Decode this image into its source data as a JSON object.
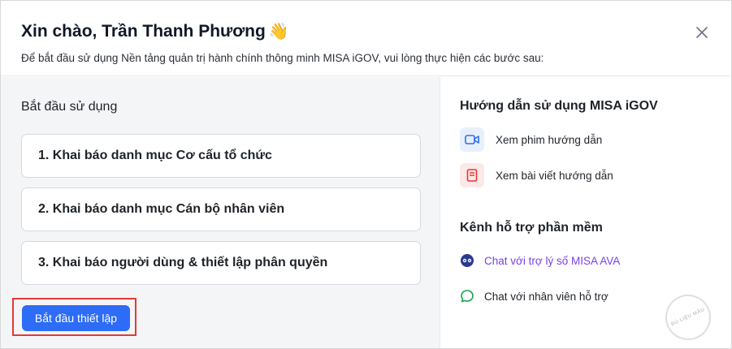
{
  "header": {
    "title": "Xin chào, Trần Thanh Phương",
    "wave_emoji": "👋",
    "subtitle": "Để bắt đầu sử dụng Nền tảng quản trị hành chính thông minh MISA iGOV, vui lòng thực hiện các bước sau:",
    "close_icon": "close-icon"
  },
  "left": {
    "section_title": "Bắt đầu sử dụng",
    "steps": [
      {
        "label": "1. Khai báo danh mục Cơ cấu tổ chức"
      },
      {
        "label": "2. Khai báo danh mục Cán bộ nhân viên"
      },
      {
        "label": "3. Khai báo người dùng & thiết lập phân quyền"
      }
    ],
    "start_button_label": "Bắt đầu thiết lập",
    "highlight_color": "#e53935",
    "accent_color": "#2d6cf6"
  },
  "right": {
    "guide_title": "Hướng dẫn sử dụng MISA iGOV",
    "guide_items": [
      {
        "label": "Xem phim hướng dẫn",
        "icon": "video-camera-icon"
      },
      {
        "label": "Xem bài viết hướng dẫn",
        "icon": "book-icon"
      }
    ],
    "support_title": "Kênh hỗ trợ phần mềm",
    "support_items": [
      {
        "label": "Chat với trợ lý số MISA AVA",
        "icon": "bot-avatar-icon"
      },
      {
        "label": "Chat với nhân viên hỗ trợ",
        "icon": "chat-bubble-icon"
      }
    ]
  },
  "watermark": {
    "text": "ĐỦ LIỆU MẪU"
  }
}
